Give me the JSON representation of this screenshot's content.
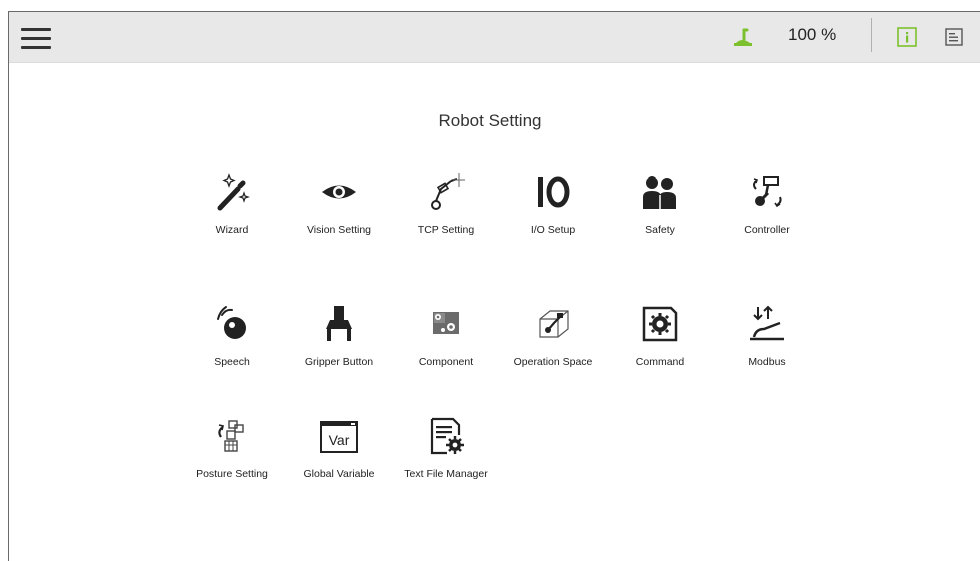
{
  "header": {
    "speed_value": "100 %",
    "icons": [
      "menu-icon",
      "robot-status-icon",
      "info-icon",
      "document-icon"
    ],
    "accent_color": "#7cc12d"
  },
  "page": {
    "title": "Robot Setting"
  },
  "tiles": [
    {
      "label": "Wizard",
      "icon": "wizard-wand-icon"
    },
    {
      "label": "Vision Setting",
      "icon": "eye-icon"
    },
    {
      "label": "TCP Setting",
      "icon": "tcp-arm-icon"
    },
    {
      "label": "I/O Setup",
      "icon": "io-icon"
    },
    {
      "label": "Safety",
      "icon": "people-icon"
    },
    {
      "label": "Controller",
      "icon": "controller-icon"
    },
    {
      "label": "Speech",
      "icon": "speech-icon"
    },
    {
      "label": "Gripper Button",
      "icon": "gripper-icon"
    },
    {
      "label": "Component",
      "icon": "component-icon"
    },
    {
      "label": "Operation Space",
      "icon": "operation-space-icon"
    },
    {
      "label": "Command",
      "icon": "command-icon"
    },
    {
      "label": "Modbus",
      "icon": "modbus-icon"
    },
    {
      "label": "Posture Setting",
      "icon": "posture-icon"
    },
    {
      "label": "Global Variable",
      "icon": "variable-icon"
    },
    {
      "label": "Text File Manager",
      "icon": "text-file-icon"
    }
  ],
  "var_icon_text": "Var"
}
